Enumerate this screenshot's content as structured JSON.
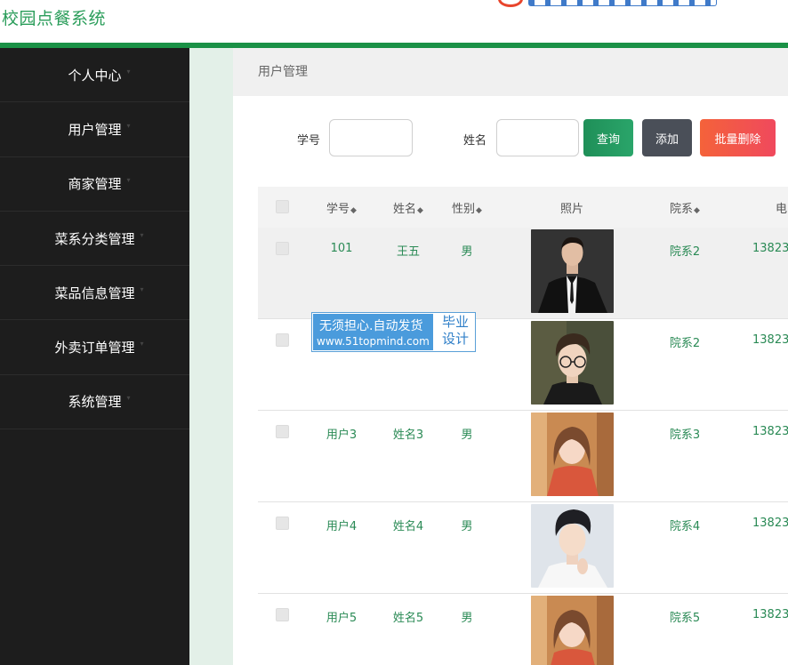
{
  "app": {
    "title": "校园点餐系统"
  },
  "sidebar": {
    "items": [
      {
        "label": "个人中心"
      },
      {
        "label": "用户管理"
      },
      {
        "label": "商家管理"
      },
      {
        "label": "菜系分类管理"
      },
      {
        "label": "菜品信息管理"
      },
      {
        "label": "外卖订单管理"
      },
      {
        "label": "系统管理"
      }
    ]
  },
  "breadcrumb": {
    "current": "用户管理"
  },
  "search": {
    "student_id_label": "学号",
    "student_id_value": "",
    "name_label": "姓名",
    "name_value": "",
    "query_button": "查询",
    "add_button": "添加",
    "batch_delete_button": "批量删除"
  },
  "table": {
    "headers": {
      "student_id": "学号",
      "name": "姓名",
      "gender": "性别",
      "photo": "照片",
      "department": "院系",
      "phone": "电"
    },
    "rows": [
      {
        "student_id": "101",
        "name": "王五",
        "gender": "男",
        "department": "院系2",
        "phone": "13823"
      },
      {
        "student_id": "",
        "name": "",
        "gender": "",
        "department": "院系2",
        "phone": "13823"
      },
      {
        "student_id": "用户3",
        "name": "姓名3",
        "gender": "男",
        "department": "院系3",
        "phone": "13823"
      },
      {
        "student_id": "用户4",
        "name": "姓名4",
        "gender": "男",
        "department": "院系4",
        "phone": "13823"
      },
      {
        "student_id": "用户5",
        "name": "姓名5",
        "gender": "男",
        "department": "院系5",
        "phone": "13823"
      }
    ]
  },
  "watermark": {
    "line1": "无须担心.自动发货",
    "line2": "www.51topmind.com",
    "right_top": "毕业",
    "right_bottom": "设计"
  },
  "colors": {
    "brand_green": "#2a9d5a",
    "sidebar_bg": "#1d1d1d",
    "accent_bar": "#1a9146",
    "cell_text": "#2a8a55"
  }
}
